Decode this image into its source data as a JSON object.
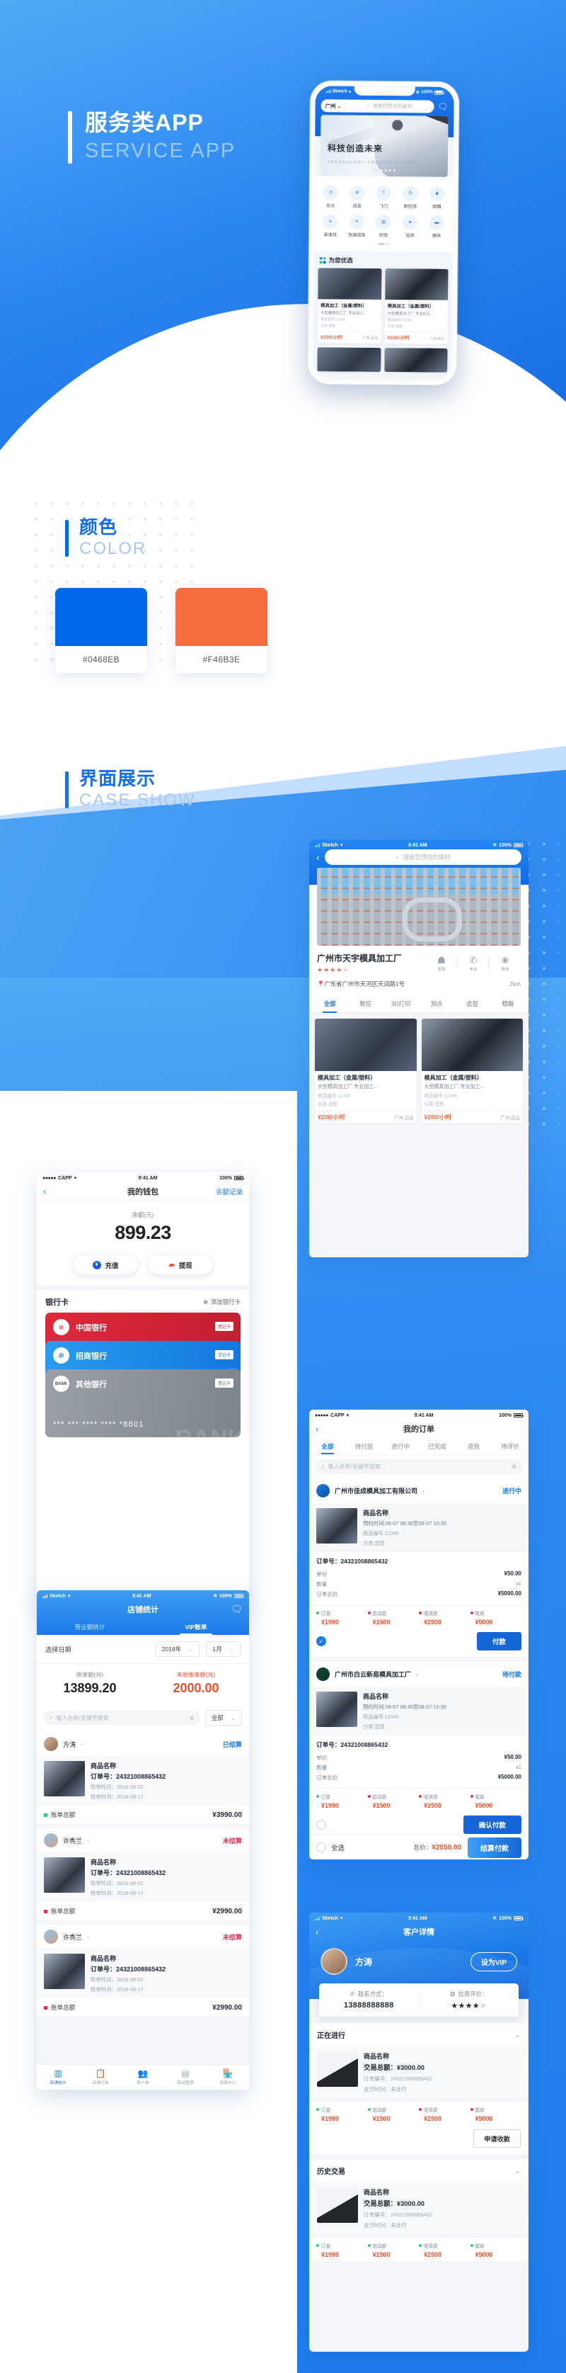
{
  "hero": {
    "title_cn": "服务类APP",
    "title_en": "SERVICE APP"
  },
  "color_section": {
    "title_cn": "颜色",
    "title_en": "COLOR",
    "swatches": [
      {
        "hex": "#0468EB",
        "label": "#0468EB"
      },
      {
        "hex": "#F46B3E",
        "label": "#F46B3E"
      }
    ]
  },
  "case_section": {
    "title_cn": "界面展示",
    "title_en": "CASE SHOW"
  },
  "home_screen": {
    "status": {
      "carrier": "Sketch",
      "time": "9:41 AM",
      "battery": "100%"
    },
    "city": "广州",
    "search_placeholder": "搜索您想找的建材",
    "banner": {
      "title": "科技创造未来",
      "subtitle": "TECHNOLOGY CREATES FUTURE"
    },
    "nav_row1": [
      {
        "label": "测点",
        "icon": "power-icon"
      },
      {
        "label": "造型",
        "icon": "mold-icon"
      },
      {
        "label": "飞刀",
        "icon": "cutter-icon"
      },
      {
        "label": "数控铣",
        "icon": "cnc-icon"
      },
      {
        "label": "精雕",
        "icon": "engrave-icon"
      }
    ],
    "nav_row2": [
      {
        "label": "高速铣",
        "icon": "highspeed-icon"
      },
      {
        "label": "快速成型",
        "icon": "rapid-icon"
      },
      {
        "label": "侧铣",
        "icon": "sidemill-icon"
      },
      {
        "label": "钻床",
        "icon": "drill-icon"
      },
      {
        "label": "磨床",
        "icon": "grinder-icon"
      }
    ],
    "section_title": "为您优选",
    "products": [
      {
        "title": "模具加工（金属/塑料）",
        "desc": "大型模具加工厂,专业加工...",
        "code": "商品编号:12345",
        "category": "分类:造型",
        "price": "¥200/小时",
        "location": "广州 白云"
      },
      {
        "title": "模具加工（金属/塑料）",
        "desc": "大型模具加工厂,专业加工...",
        "code": "商品编号:12345",
        "category": "分类:造型",
        "price": "¥200/小时",
        "location": "广州 白云"
      }
    ]
  },
  "factory_screen": {
    "status": {
      "carrier": "Sketch",
      "time": "9:41 AM",
      "battery": "100%"
    },
    "search_placeholder": "搜索您想找的建材",
    "name": "广州市天宇模具加工厂",
    "rating": 4,
    "actions": [
      {
        "label": "客服",
        "icon": "customer-service-icon"
      },
      {
        "label": "电话",
        "icon": "phone-icon"
      },
      {
        "label": "微信",
        "icon": "wechat-icon"
      }
    ],
    "address": "广东省广州市天河区天润路1号",
    "distance": "2km",
    "tabs": [
      "全部",
      "数控",
      "3D打印",
      "测点",
      "造型",
      "精雕"
    ],
    "active_tab": "全部",
    "products": [
      {
        "title": "模具加工（金属/塑料）",
        "desc": "大型模具加工厂,专业加工...",
        "code": "商品编号:12345",
        "category": "分类:造型",
        "price": "¥200/小时",
        "location": "广州 白云"
      },
      {
        "title": "模具加工（金属/塑料）",
        "desc": "大型模具加工厂,专业加工...",
        "code": "商品编号:12345",
        "category": "分类:造型",
        "price": "¥200/小时",
        "location": "广州 白云"
      }
    ]
  },
  "wallet_screen": {
    "status": {
      "carrier": "CAPP",
      "time": "9:41 AM",
      "battery": "100%"
    },
    "title": "我的钱包",
    "right_link": "余额记录",
    "balance_label": "余额(元)",
    "balance": "899.23",
    "buttons": [
      {
        "label": "充值",
        "icon": "recharge-icon"
      },
      {
        "label": "提现",
        "icon": "withdraw-icon"
      }
    ],
    "cards_title": "银行卡",
    "add_card": "添加银行卡",
    "cards": [
      {
        "name": "中国银行",
        "type": "借记卡",
        "logo": "boc-logo-icon",
        "number": ""
      },
      {
        "name": "招商银行",
        "type": "贷记卡",
        "logo": "cmb-logo-icon",
        "number": ""
      },
      {
        "name": "其他银行",
        "type": "借记卡",
        "logo": "bank-logo-icon",
        "number": "*** *** **** **** *8801"
      }
    ]
  },
  "orders_screen": {
    "status": {
      "carrier": "CAPP",
      "time": "9:41 AM",
      "battery": "100%"
    },
    "title": "我的订单",
    "tabs": [
      "全部",
      "待付款",
      "进行中",
      "已完成",
      "退款",
      "待评价"
    ],
    "active_tab": "全部",
    "search_placeholder": "输入名称/关键字搜索",
    "orders": [
      {
        "shop": "广州市佳成模具加工有限公司",
        "status": "进行中",
        "product": "商品名称",
        "time": "预约时间:08-07 08:30至08-07 10:30",
        "code": "商品编号:12345",
        "category": "分类:造型",
        "order_no_label": "订单号：",
        "order_no": "24321008865432",
        "unit_price_label": "单价",
        "unit_price": "¥50.00",
        "qty_label": "数量",
        "qty": "x1",
        "total_label": "订单总价",
        "total": "¥5000.00",
        "payments": [
          {
            "label": "订金",
            "value": "¥1990",
            "dot": "#2ECC71"
          },
          {
            "label": "启动款",
            "value": "¥1500",
            "dot": "#E03050"
          },
          {
            "label": "收货款",
            "value": "¥2500",
            "dot": "#E03050"
          },
          {
            "label": "尾款",
            "value": "¥5000",
            "dot": "#E03050"
          }
        ],
        "checked": true,
        "action": "付款"
      },
      {
        "shop": "广州市白云新易模具加工厂",
        "status": "待付款",
        "product": "商品名称",
        "time": "预约时间:08-07 08:30至08-07 10:30",
        "code": "商品编号:12345",
        "category": "分类:造型",
        "order_no_label": "订单号：",
        "order_no": "24321008865432",
        "unit_price_label": "单价",
        "unit_price": "¥50.00",
        "qty_label": "数量",
        "qty": "x1",
        "total_label": "订单总价",
        "total": "¥5000.00",
        "payments": [
          {
            "label": "订金",
            "value": "¥1990",
            "dot": "#2ECC71"
          },
          {
            "label": "启动款",
            "value": "¥1500",
            "dot": "#E03050"
          },
          {
            "label": "收货款",
            "value": "¥2500",
            "dot": "#E03050"
          },
          {
            "label": "尾款",
            "value": "¥5000",
            "dot": "#E03050"
          }
        ],
        "checked": false,
        "action": "确认付款"
      }
    ],
    "footer": {
      "select_all": "全选",
      "total_label": "总价：",
      "total": "¥2050.00",
      "button": "结算付款"
    }
  },
  "shop_stats_screen": {
    "status": {
      "carrier": "Sketch",
      "time": "9:41 AM",
      "battery": "100%"
    },
    "title": "店铺统计",
    "tabs": [
      "营业额统计",
      "VIP账单"
    ],
    "active_tab": "VIP账单",
    "date_label": "选择日期",
    "year": "2018年",
    "month": "1月",
    "amounts": [
      {
        "label": "账单额(元)",
        "value": "13899.20"
      },
      {
        "label": "未收账单额(元)",
        "value": "2000.00"
      }
    ],
    "search_placeholder": "输入名称/关键字搜索",
    "filter": "全部",
    "bills": [
      {
        "user": "方涛",
        "status": "已结算",
        "product": "商品名称",
        "order_no_label": "订单号：",
        "order_no": "24321008865432",
        "date1": "账单时间：2018-08-02",
        "date2": "账单时间：2018-08-17",
        "total_label": "账单总额",
        "total": "¥3990.00",
        "dot": "#2ECC71"
      },
      {
        "user": "许秀兰",
        "status": "未结算",
        "product": "商品名称",
        "order_no_label": "订单号：",
        "order_no": "24321008865432",
        "date1": "账单时间：2018-08-02",
        "date2": "账单时间：2018-08-17",
        "total_label": "账单总额",
        "total": "¥2990.00",
        "dot": "#E03050"
      },
      {
        "user": "许秀兰",
        "status": "未结算",
        "product": "商品名称",
        "order_no_label": "订单号：",
        "order_no": "24321008865432",
        "date1": "账单时间：2018-08-02",
        "date2": "账单时间：2018-08-17",
        "total_label": "账单总额",
        "total": "¥2990.00",
        "dot": "#E03050"
      }
    ],
    "tabbar": [
      {
        "label": "店铺统计",
        "icon": "chart-icon"
      },
      {
        "label": "店铺订单",
        "icon": "clipboard-icon"
      },
      {
        "label": "客户端",
        "icon": "users-icon"
      },
      {
        "label": "商品管理",
        "icon": "box-icon"
      },
      {
        "label": "商家中心",
        "icon": "shop-icon"
      }
    ]
  },
  "customer_screen": {
    "status": {
      "carrier": "Sketch",
      "time": "9:41 AM",
      "battery": "100%"
    },
    "title": "客户详情",
    "name": "方涛",
    "vip_button": "设为VIP",
    "contact_label": "联系方式：",
    "contact": "13888888888",
    "credit_label": "信用评价：",
    "credit_rating": 4,
    "ongoing_title": "正在进行",
    "history_title": "历史交易",
    "ongoing": {
      "product": "商品名称",
      "total_label": "交易总额：",
      "total": "¥3000.00",
      "order_label": "订单编号：",
      "order_no": "24321008865432",
      "pay_label": "支付时间：",
      "pay_time": "未支付",
      "payments": [
        {
          "label": "订金",
          "value": "¥1990",
          "dot": "#2ECC71"
        },
        {
          "label": "启动款",
          "value": "¥1500",
          "dot": "#2ECC71"
        },
        {
          "label": "收货款",
          "value": "¥2500",
          "dot": "#E03050"
        },
        {
          "label": "尾款",
          "value": "¥5000",
          "dot": "#E03050"
        }
      ],
      "action": "申请收款"
    },
    "history": {
      "product": "商品名称",
      "total_label": "交易总额：",
      "total": "¥3000.00",
      "order_label": "订单编号：",
      "order_no": "24321008865432",
      "pay_label": "支付时间：",
      "pay_time": "未支付",
      "payments": [
        {
          "label": "订金",
          "value": "¥1990",
          "dot": "#2ECC71"
        },
        {
          "label": "启动款",
          "value": "¥1500",
          "dot": "#2ECC71"
        },
        {
          "label": "收货款",
          "value": "¥2500",
          "dot": "#2ECC71"
        },
        {
          "label": "尾款",
          "value": "¥5000",
          "dot": "#2ECC71"
        }
      ]
    }
  }
}
